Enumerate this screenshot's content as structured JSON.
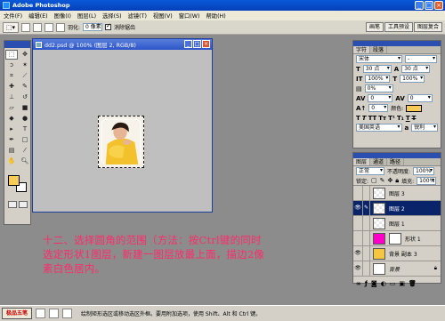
{
  "app": {
    "title": "Adobe Photoshop"
  },
  "menu": [
    "文件(F)",
    "编辑(E)",
    "图像(I)",
    "图层(L)",
    "选择(S)",
    "滤镜(T)",
    "视图(V)",
    "窗口(W)",
    "帮助(H)"
  ],
  "options": {
    "feather_label": "羽化:",
    "feather_value": "0 像素",
    "antialias_label": "消除锯齿",
    "well_tabs": [
      "画笔",
      "工具预设",
      "图层复合"
    ]
  },
  "document": {
    "title": "dd2.psd @ 100% (图层 2, RGB/8)"
  },
  "character_panel": {
    "tabs": [
      "字符",
      "段落"
    ],
    "font": "宋体",
    "style": "-",
    "size": "30 点",
    "leading": "30 点",
    "vscale": "100%",
    "hscale": "100%",
    "tracking": "0%",
    "kerning": "0",
    "baseline": "0",
    "color_label": "颜色:",
    "language": "美国英语",
    "antialias": "锐利",
    "colors": {
      "text_color": "#f6cb57"
    }
  },
  "layers_panel": {
    "tabs": [
      "图层",
      "通道",
      "路径"
    ],
    "blend_mode": "正常",
    "opacity_label": "不透明度:",
    "opacity": "100%",
    "lock_label": "锁定:",
    "fill_label": "填充:",
    "fill": "100%",
    "layers": [
      {
        "name": "图层 3",
        "visible": false
      },
      {
        "name": "图层 2",
        "visible": true
      },
      {
        "name": "图层 1",
        "visible": false
      },
      {
        "name": "形状 1",
        "visible": false
      },
      {
        "name": "背景 副本 3",
        "visible": true
      },
      {
        "name": "背景",
        "visible": true
      }
    ]
  },
  "instruction": {
    "line1": "十二、选择圆角的范围（方法：按Ctrl键的同时",
    "line2": "选定形状1图层，新建一图层放最上面，描边2像",
    "line3": "素白色居内。"
  },
  "taskbar": {
    "start_label": "极品五笔",
    "status": "绘制矩形选区或移动选区外框。要用附加选项，使用 Shift、Alt 和 Ctrl 键。"
  },
  "colors": {
    "instruction": "#ff2a6a",
    "foreground": "#f6cb57",
    "background": "#ffffff",
    "active_layer": "#0a246a"
  }
}
